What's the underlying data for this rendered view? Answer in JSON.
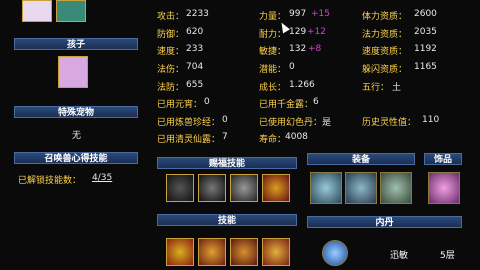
{
  "sections": {
    "child": "孩子",
    "special_pet": "特殊宠物",
    "special_pet_value": "无",
    "summon_skill": "召唤兽心得技能",
    "unlocked_label": "已解锁技能数：",
    "unlocked_value": "4/35",
    "spirit_skill": "赐福技能",
    "skill": "技能",
    "equipment": "装备",
    "accessory": "饰品",
    "inner_core": "内丹",
    "core_name": "迅敏",
    "core_level": "5层"
  },
  "stats": {
    "attack": {
      "label": "攻击：",
      "value": "2233"
    },
    "defense": {
      "label": "防御：",
      "value": "620"
    },
    "speed": {
      "label": "速度：",
      "value": "233"
    },
    "magic": {
      "label": "法伤：",
      "value": "704"
    },
    "magic_def": {
      "label": "法防：",
      "value": "655"
    },
    "strength": {
      "label": "力量：",
      "value": "997",
      "bonus": "+15"
    },
    "endurance": {
      "label": "耐力：",
      "value": "129",
      "bonus": "+12"
    },
    "agility": {
      "label": "敏捷：",
      "value": "132",
      "bonus": "+8"
    },
    "potential": {
      "label": "潜能：",
      "value": "0"
    },
    "growth": {
      "label": "成长：",
      "value": "1.266"
    },
    "hp_apt": {
      "label": "体力资质：",
      "value": "2600"
    },
    "mp_apt": {
      "label": "法力资质：",
      "value": "2035"
    },
    "spd_apt": {
      "label": "速度资质：",
      "value": "1192"
    },
    "dodge_apt": {
      "label": "躲闪资质：",
      "value": "1165"
    },
    "element": {
      "label": "五行：",
      "value": "土"
    },
    "yuanxiao": {
      "label": "已用元宵：",
      "value": "0"
    },
    "qianjinlu": {
      "label": "已用千金露：",
      "value": "6"
    },
    "lianshou": {
      "label": "已用炼兽珍经：",
      "value": "0"
    },
    "huanse": {
      "label": "已使用幻色丹：",
      "value": "是"
    },
    "history_spirit": {
      "label": "历史灵性值：",
      "value": "110"
    },
    "qingling": {
      "label": "已用清灵仙露：",
      "value": "7"
    },
    "lifespan": {
      "label": "寿命：",
      "value": "4008"
    }
  },
  "icons": {
    "spirit": [
      "spirit-skill-1-icon",
      "spirit-skill-2-icon",
      "spirit-skill-3-icon",
      "spirit-skill-4-icon"
    ],
    "skills": [
      "skill-1-icon",
      "skill-2-icon",
      "skill-3-icon",
      "skill-4-icon"
    ],
    "equip": [
      "equip-armor-icon",
      "equip-collar-icon",
      "equip-bracelet-icon"
    ]
  },
  "colors": {
    "bar_bg": "#1a2f55",
    "gold": "#ffd24a",
    "bonus": "#d040d0"
  }
}
